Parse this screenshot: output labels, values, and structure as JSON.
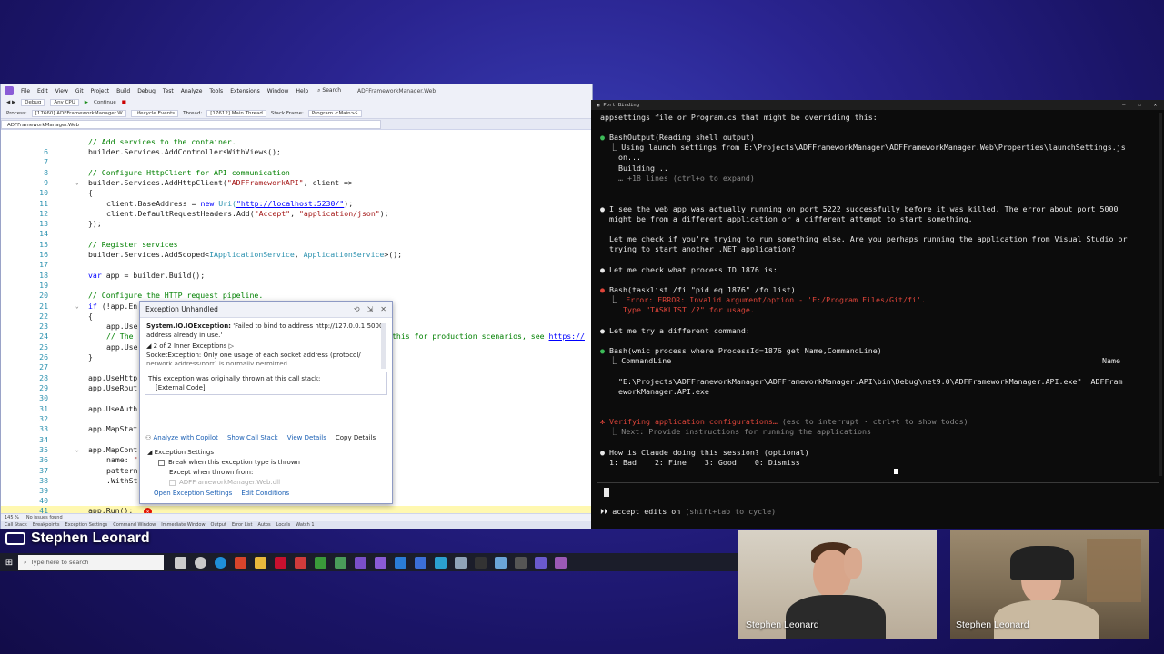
{
  "vs": {
    "menu": [
      "File",
      "Edit",
      "View",
      "Git",
      "Project",
      "Build",
      "Debug",
      "Test",
      "Analyze",
      "Tools",
      "Extensions",
      "Window",
      "Help"
    ],
    "search": "Search",
    "project_title": "ADFFrameworkManager.Web",
    "toolbar": {
      "config": "Debug",
      "platform": "Any CPU",
      "continue": "Continue"
    },
    "toolbar2": {
      "process_label": "Process:",
      "process": "[17660] ADFFrameworkManager.W",
      "lifecycle": "Lifecycle Events",
      "thread_label": "Thread:",
      "thread": "[17612] Main Thread",
      "stackframe_label": "Stack Frame:",
      "stackframe": "Program.<Main>$"
    },
    "tab": "ADFFrameworkManager.Web",
    "status": {
      "zoom": "145 %",
      "issues": "No issues found",
      "panes": [
        "Call Stack",
        "Breakpoints",
        "Exception Settings",
        "Command Window",
        "Immediate Window",
        "Output",
        "Error List",
        "Autos",
        "Locals",
        "Watch 1"
      ]
    }
  },
  "code": {
    "l5": "// Add services to the container.",
    "l6": "builder.Services.AddControllersWithViews();",
    "l8": "// Configure HttpClient for API communication",
    "l9a": "builder.Services.AddHttpClient(",
    "l9b": "\"ADFFrameworkAPI\"",
    "l9c": ", client =>",
    "l10": "{",
    "l11a": "client.BaseAddress = ",
    "l11b": "new",
    "l11c": " Uri(",
    "l11d": "\"http://localhost:5230/\"",
    "l11e": ");",
    "l12a": "client.DefaultRequestHeaders.Add(",
    "l12b": "\"Accept\"",
    "l12c": ", ",
    "l12d": "\"application/json\"",
    "l12e": ");",
    "l13": "});",
    "l15": "// Register services",
    "l16a": "builder.Services.AddScoped<",
    "l16b": "IApplicationService",
    "l16c": ", ",
    "l16d": "ApplicationService",
    "l16e": ">();",
    "l18a": "var",
    "l18b": " app = builder.Build();",
    "l20": "// Configure the HTTP request pipeline.",
    "l21a": "if",
    "l21b": " (!app.En",
    "l22": "{",
    "l23": "app.Use",
    "l24": "// The",
    "l24b": "this for production scenarios, see ",
    "l24c": "https://",
    "l25": "app.Use",
    "l26": "}",
    "l28": "app.UseHttp",
    "l29": "app.UseRout",
    "l31": "app.UseAuth",
    "l33": "app.MapStat",
    "l35": "app.MapCont",
    "l36a": "name: ",
    "l36b": "\"",
    "l37": "pattern",
    "l38": ".WithSt",
    "l41": "app.Run();"
  },
  "exception": {
    "title": "Exception Unhandled",
    "type": "System.IO.IOException:",
    "message": "'Failed to bind to address http://127.0.0.1:5000: address already in use.'",
    "inner_count": "2 of 2 Inner Exceptions",
    "inner_msg": "SocketException: Only one usage of each socket address (protocol/",
    "inner_msg2": "network address/port) is normally permitted.",
    "thrown_msg": "This exception was originally thrown at this call stack:",
    "external": "[External Code]",
    "actions": [
      "Analyze with Copilot",
      "Show Call Stack",
      "View Details",
      "Copy Details"
    ],
    "settings_title": "Exception Settings",
    "break_when": "Break when this exception type is thrown",
    "except_when": "Except when thrown from:",
    "except_item": "ADFFrameworkManager.Web.dll",
    "open_settings": "Open Exception Settings",
    "edit_conditions": "Edit Conditions"
  },
  "terminal": {
    "title": "Port Binding",
    "lines": {
      "t1": "appsettings file or Program.cs that might be overriding this:",
      "t2a": "●",
      "t2b": " BashOutput(Reading shell output)",
      "t3": "  ⎿ Using launch settings from E:\\Projects\\ADFFrameworkManager\\ADFFrameworkManager.Web\\Properties\\launchSettings.js",
      "t4": "    on...",
      "t5": "    Building...",
      "t6": "    … +18 lines (ctrl+o to expand)",
      "t7a": "●",
      "t7b": " I see the web app was actually running on port 5222 successfully before it was killed. The error about port 5000",
      "t8": "  might be from a different application or a different attempt to start something.",
      "t9": "  Let me check if you're trying to run something else. Are you perhaps running the application from Visual Studio or",
      "t10": "  trying to start another .NET application?",
      "t11a": "●",
      "t11b": " Let me check what process ID 1876 is:",
      "t12a": "●",
      "t12b": " Bash(tasklist /fi \"pid eq 1876\" /fo list)",
      "t13a": "  ⎿  ",
      "t13b": "Error: ERROR: Invalid argument/option - 'E:/Program Files/Git/fi'.",
      "t14": "     Type \"TASKLIST /?\" for usage.",
      "t15a": "●",
      "t15b": " Let me try a different command:",
      "t16a": "●",
      "t16b": " Bash(wmic process where ProcessId=1876 get Name,CommandLine)",
      "t17": "  ⎿ CommandLine",
      "t17b": "Name",
      "t18": "    \"E:\\Projects\\ADFFrameworkManager\\ADFFrameworkManager.API\\bin\\Debug\\net9.0\\ADFFrameworkManager.API.exe\"  ADFFram",
      "t19": "    eworkManager.API.exe",
      "t20a": "✻",
      "t20b": " Verifying application configurations…",
      "t20c": " (esc to interrupt · ctrl+t to show todos)",
      "t21": "  ⎿ Next: Provide instructions for running the applications",
      "t22a": "●",
      "t22b": " How is Claude doing this session? (optional)",
      "t23": "  1: Bad    2: Fine    3: Good    0: Dismiss"
    },
    "mode": "⏵⏵ accept edits on",
    "mode_hint": " (shift+tab to cycle)"
  },
  "taskbar": {
    "search_placeholder": "Type here to search"
  },
  "overlay": {
    "lower_third_name": "Stephen Leonard"
  },
  "cams": {
    "cam1_name": "Stephen Leonard",
    "cam2_name": "Stephen Leonard"
  }
}
